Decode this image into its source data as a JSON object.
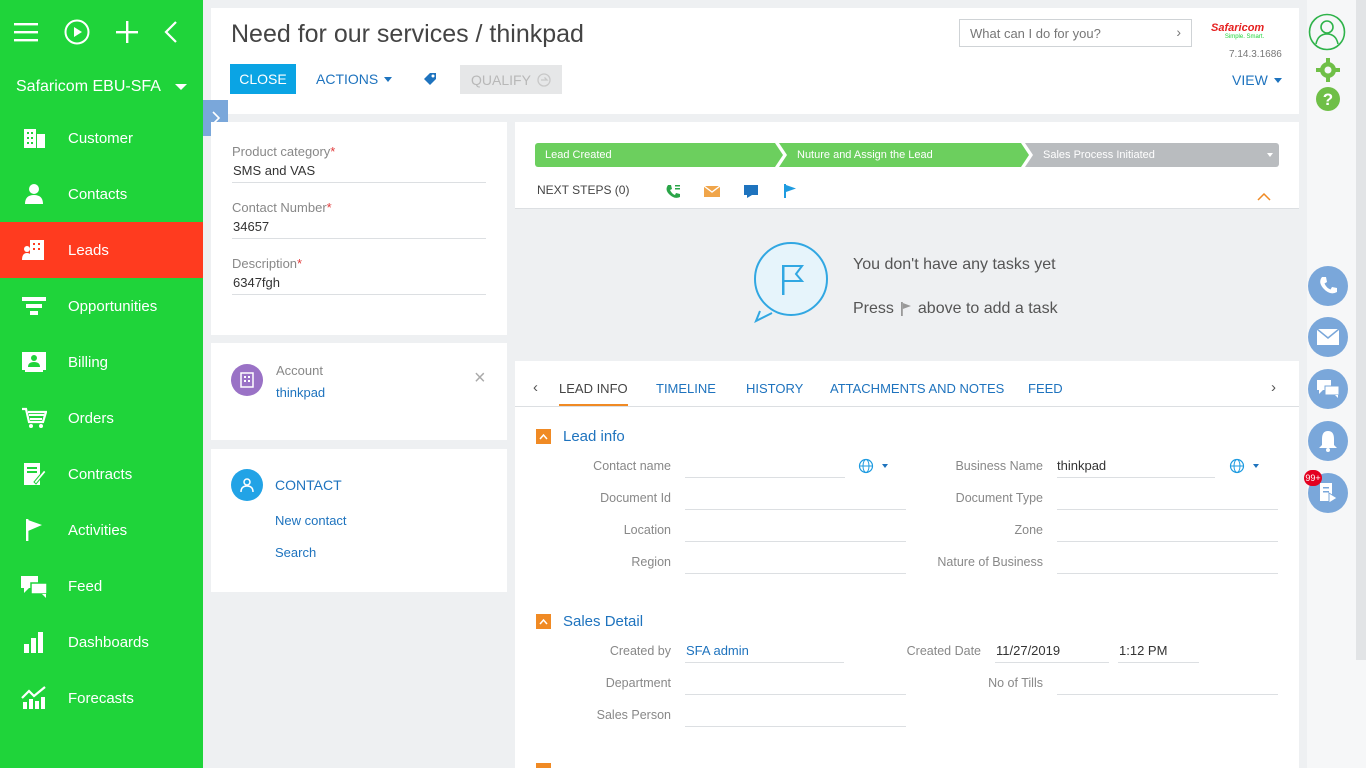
{
  "sidebar": {
    "brand": "Safaricom EBU-SFA",
    "items": [
      {
        "label": "Customer",
        "icon": "building-icon"
      },
      {
        "label": "Contacts",
        "icon": "person-icon"
      },
      {
        "label": "Leads",
        "icon": "leads-icon"
      },
      {
        "label": "Opportunities",
        "icon": "funnel-icon"
      },
      {
        "label": "Billing",
        "icon": "billing-icon"
      },
      {
        "label": "Orders",
        "icon": "cart-icon"
      },
      {
        "label": "Contracts",
        "icon": "contract-icon"
      },
      {
        "label": "Activities",
        "icon": "flag-icon"
      },
      {
        "label": "Feed",
        "icon": "chat-icon"
      },
      {
        "label": "Dashboards",
        "icon": "bar-chart-icon"
      },
      {
        "label": "Forecasts",
        "icon": "forecast-icon"
      }
    ],
    "active_item": "Leads"
  },
  "header": {
    "title": "Need for our services / thinkpad",
    "close_label": "CLOSE",
    "actions_label": "ACTIONS",
    "qualify_label": "QUALIFY",
    "search_placeholder": "What can I do for you?",
    "logo_text": "Safaricom",
    "logo_sub": "Simple. Smart.",
    "version": "7.14.3.1686",
    "view_label": "VIEW"
  },
  "lead_card": {
    "product_category_label": "Product category",
    "product_category_value": "SMS and VAS",
    "contact_number_label": "Contact Number",
    "contact_number_value": "34657",
    "description_label": "Description",
    "description_value": "6347fgh",
    "required_mark": "*"
  },
  "account_card": {
    "label": "Account",
    "value": "thinkpad",
    "close_symbol": "×"
  },
  "contact_card": {
    "title": "CONTACT",
    "new_contact": "New contact",
    "search": "Search"
  },
  "process": {
    "stages": [
      {
        "label": "Lead Created",
        "status": "done"
      },
      {
        "label": "Nuture and Assign the Lead",
        "status": "done"
      },
      {
        "label": "Sales Process Initiated",
        "status": "pending"
      }
    ],
    "colors": {
      "done": "#6ccf5e",
      "pending": "#b9bcbf"
    },
    "next_steps": "NEXT STEPS (0)",
    "empty_line1": "You don't have any tasks yet",
    "empty_line2a": "Press",
    "empty_line2b": "above to add a task"
  },
  "tabs": [
    "LEAD INFO",
    "TIMELINE",
    "HISTORY",
    "ATTACHMENTS AND NOTES",
    "FEED"
  ],
  "lead_info": {
    "title": "Lead info",
    "contact_name_label": "Contact name",
    "contact_name_value": "",
    "business_name_label": "Business Name",
    "business_name_value": "thinkpad",
    "document_id_label": "Document Id",
    "document_type_label": "Document Type",
    "location_label": "Location",
    "zone_label": "Zone",
    "region_label": "Region",
    "nature_label": "Nature of Business"
  },
  "sales_detail": {
    "title": "Sales Detail",
    "created_by_label": "Created by",
    "created_by_value": "SFA admin",
    "created_date_label": "Created Date",
    "created_date_value": "11/27/2019",
    "created_time_value": "1:12 PM",
    "department_label": "Department",
    "tills_label": "No of Tills",
    "sales_person_label": "Sales Person"
  },
  "rail": {
    "badge": "99+"
  },
  "colors": {
    "sidebar": "#1fd43a",
    "active": "#ff3b1f",
    "primary": "#0aa4e4",
    "link": "#1e73be",
    "accent": "#f08a24"
  }
}
